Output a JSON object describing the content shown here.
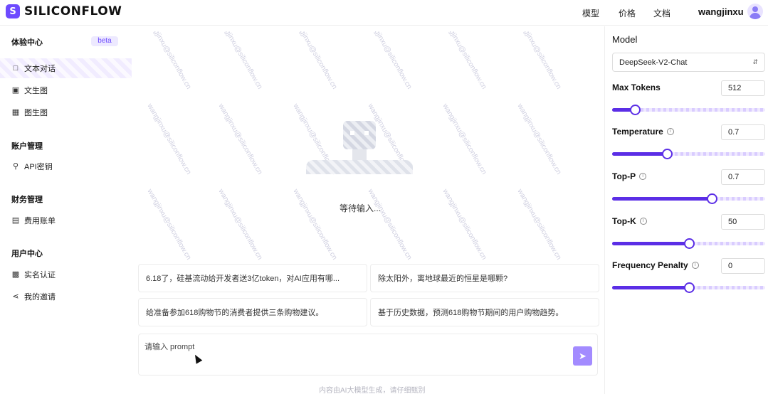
{
  "header": {
    "logo_text": "SILICONFLOW",
    "nav": [
      "模型",
      "价格",
      "文档"
    ],
    "username": "wangjinxu"
  },
  "sidebar": {
    "groups": [
      {
        "title": "体验中心",
        "badge": "beta",
        "items": [
          {
            "label": "文本对话",
            "icon": "chat-icon",
            "active": true
          },
          {
            "label": "文生图",
            "icon": "image-icon"
          },
          {
            "label": "图生图",
            "icon": "images-icon"
          }
        ]
      },
      {
        "title": "账户管理",
        "items": [
          {
            "label": "API密钥",
            "icon": "key-icon"
          }
        ]
      },
      {
        "title": "财务管理",
        "items": [
          {
            "label": "费用账单",
            "icon": "bill-icon"
          }
        ]
      },
      {
        "title": "用户中心",
        "items": [
          {
            "label": "实名认证",
            "icon": "id-card-icon"
          },
          {
            "label": "我的邀请",
            "icon": "share-icon"
          }
        ]
      }
    ]
  },
  "main": {
    "watermark": "wangjinxu@siliconflow.cn",
    "empty_state_text": "等待输入...",
    "suggestions": [
      "6.18了，硅基流动给开发者送3亿token，对AI应用有哪...",
      "除太阳外，离地球最近的恒星是哪颗?",
      "给准备参加618购物节的消费者提供三条购物建议。",
      "基于历史数据，预测618购物节期间的用户购物趋势。"
    ],
    "prompt_placeholder": "请输入 prompt",
    "footer_note": "内容由AI大模型生成，请仔细甄别"
  },
  "panel": {
    "model_label": "Model",
    "model_value": "DeepSeek-V2-Chat",
    "params": [
      {
        "label": "Max Tokens",
        "value": "512",
        "fraction": 0.15,
        "info": false
      },
      {
        "label": "Temperature",
        "value": "0.7",
        "fraction": 0.36,
        "info": true
      },
      {
        "label": "Top-P",
        "value": "0.7",
        "fraction": 0.65,
        "info": true
      },
      {
        "label": "Top-K",
        "value": "50",
        "fraction": 0.5,
        "info": true
      },
      {
        "label": "Frequency Penalty",
        "value": "0",
        "fraction": 0.5,
        "info": true
      }
    ],
    "accent_color": "#5b2ee6"
  }
}
